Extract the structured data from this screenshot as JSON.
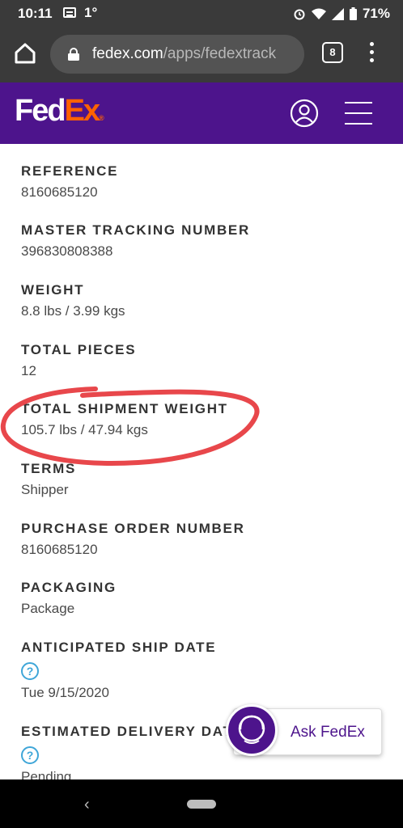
{
  "status_bar": {
    "time": "10:11",
    "temperature": "1°",
    "battery": "71%",
    "icons": [
      "notification-icon",
      "alarm-icon",
      "wifi-icon",
      "signal-icon",
      "battery-icon"
    ]
  },
  "browser": {
    "url_domain": "fedex.com",
    "url_path": "/apps/fedextrack",
    "tab_count": "8"
  },
  "header": {
    "logo_fed": "Fed",
    "logo_ex": "Ex",
    "logo_reg": "®",
    "brand_purple": "#4d148c",
    "brand_orange": "#ff6200"
  },
  "fields": [
    {
      "label": "REFERENCE",
      "value": "8160685120"
    },
    {
      "label": "MASTER TRACKING NUMBER",
      "value": "396830808388"
    },
    {
      "label": "WEIGHT",
      "value": "8.8 lbs / 3.99 kgs"
    },
    {
      "label": "TOTAL PIECES",
      "value": "12"
    },
    {
      "label": "TOTAL SHIPMENT WEIGHT",
      "value": "105.7 lbs / 47.94 kgs"
    },
    {
      "label": "TERMS",
      "value": "Shipper"
    },
    {
      "label": "PURCHASE ORDER NUMBER",
      "value": "8160685120"
    },
    {
      "label": "PACKAGING",
      "value": "Package"
    },
    {
      "label": "ANTICIPATED SHIP DATE",
      "value": "Tue 9/15/2020"
    },
    {
      "label": "ESTIMATED DELIVERY DATE",
      "value": "Pending"
    }
  ],
  "help_glyph": "?",
  "annotation_color": "#e8474b",
  "ask_fedex": {
    "label": "Ask FedEx"
  },
  "nav": {
    "back_glyph": "‹"
  }
}
